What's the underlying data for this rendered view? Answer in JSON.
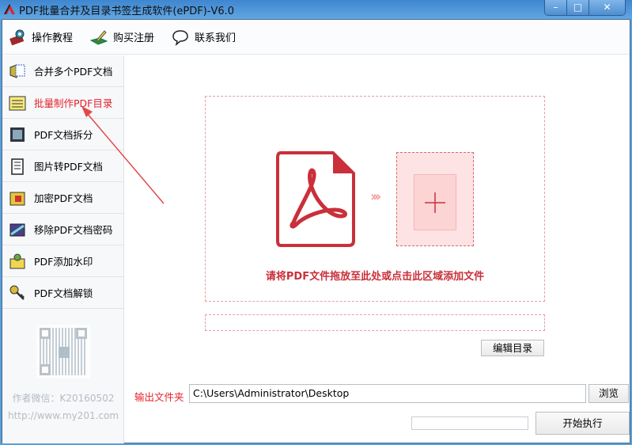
{
  "window": {
    "title": "PDF批量合并及目录书签生成软件(ePDF)-V6.0",
    "minimize": "–",
    "maximize": "□",
    "close": "✕"
  },
  "toolbar": {
    "items": [
      {
        "label": "操作教程",
        "icon": "tutorial-icon"
      },
      {
        "label": "购买注册",
        "icon": "register-icon"
      },
      {
        "label": "联系我们",
        "icon": "chat-bubble-icon"
      }
    ]
  },
  "sidebar": {
    "items": [
      {
        "label": "合并多个PDF文档",
        "icon": "merge-icon"
      },
      {
        "label": "批量制作PDF目录",
        "icon": "toc-icon",
        "active": true
      },
      {
        "label": "PDF文档拆分",
        "icon": "split-icon"
      },
      {
        "label": "图片转PDF文档",
        "icon": "image-to-pdf-icon"
      },
      {
        "label": "加密PDF文档",
        "icon": "encrypt-icon"
      },
      {
        "label": "移除PDF文档密码",
        "icon": "remove-password-icon"
      },
      {
        "label": "PDF添加水印",
        "icon": "watermark-icon"
      },
      {
        "label": "PDF文档解锁",
        "icon": "unlock-icon"
      }
    ],
    "wechat": "作者微信：K20160502",
    "website": "http://www.my201.com"
  },
  "main": {
    "drop_hint": "请将PDF文件拖放至此处或点击此区域添加文件",
    "chevrons": "›››",
    "edit_toc_button": "编辑目录",
    "output_label": "输出文件夹",
    "output_path": "C:\\Users\\Administrator\\Desktop",
    "browse_button": "浏览",
    "progress": 0,
    "start_button": "开始执行"
  },
  "colors": {
    "accent": "#e4232b",
    "pdf_red": "#c9303a"
  }
}
